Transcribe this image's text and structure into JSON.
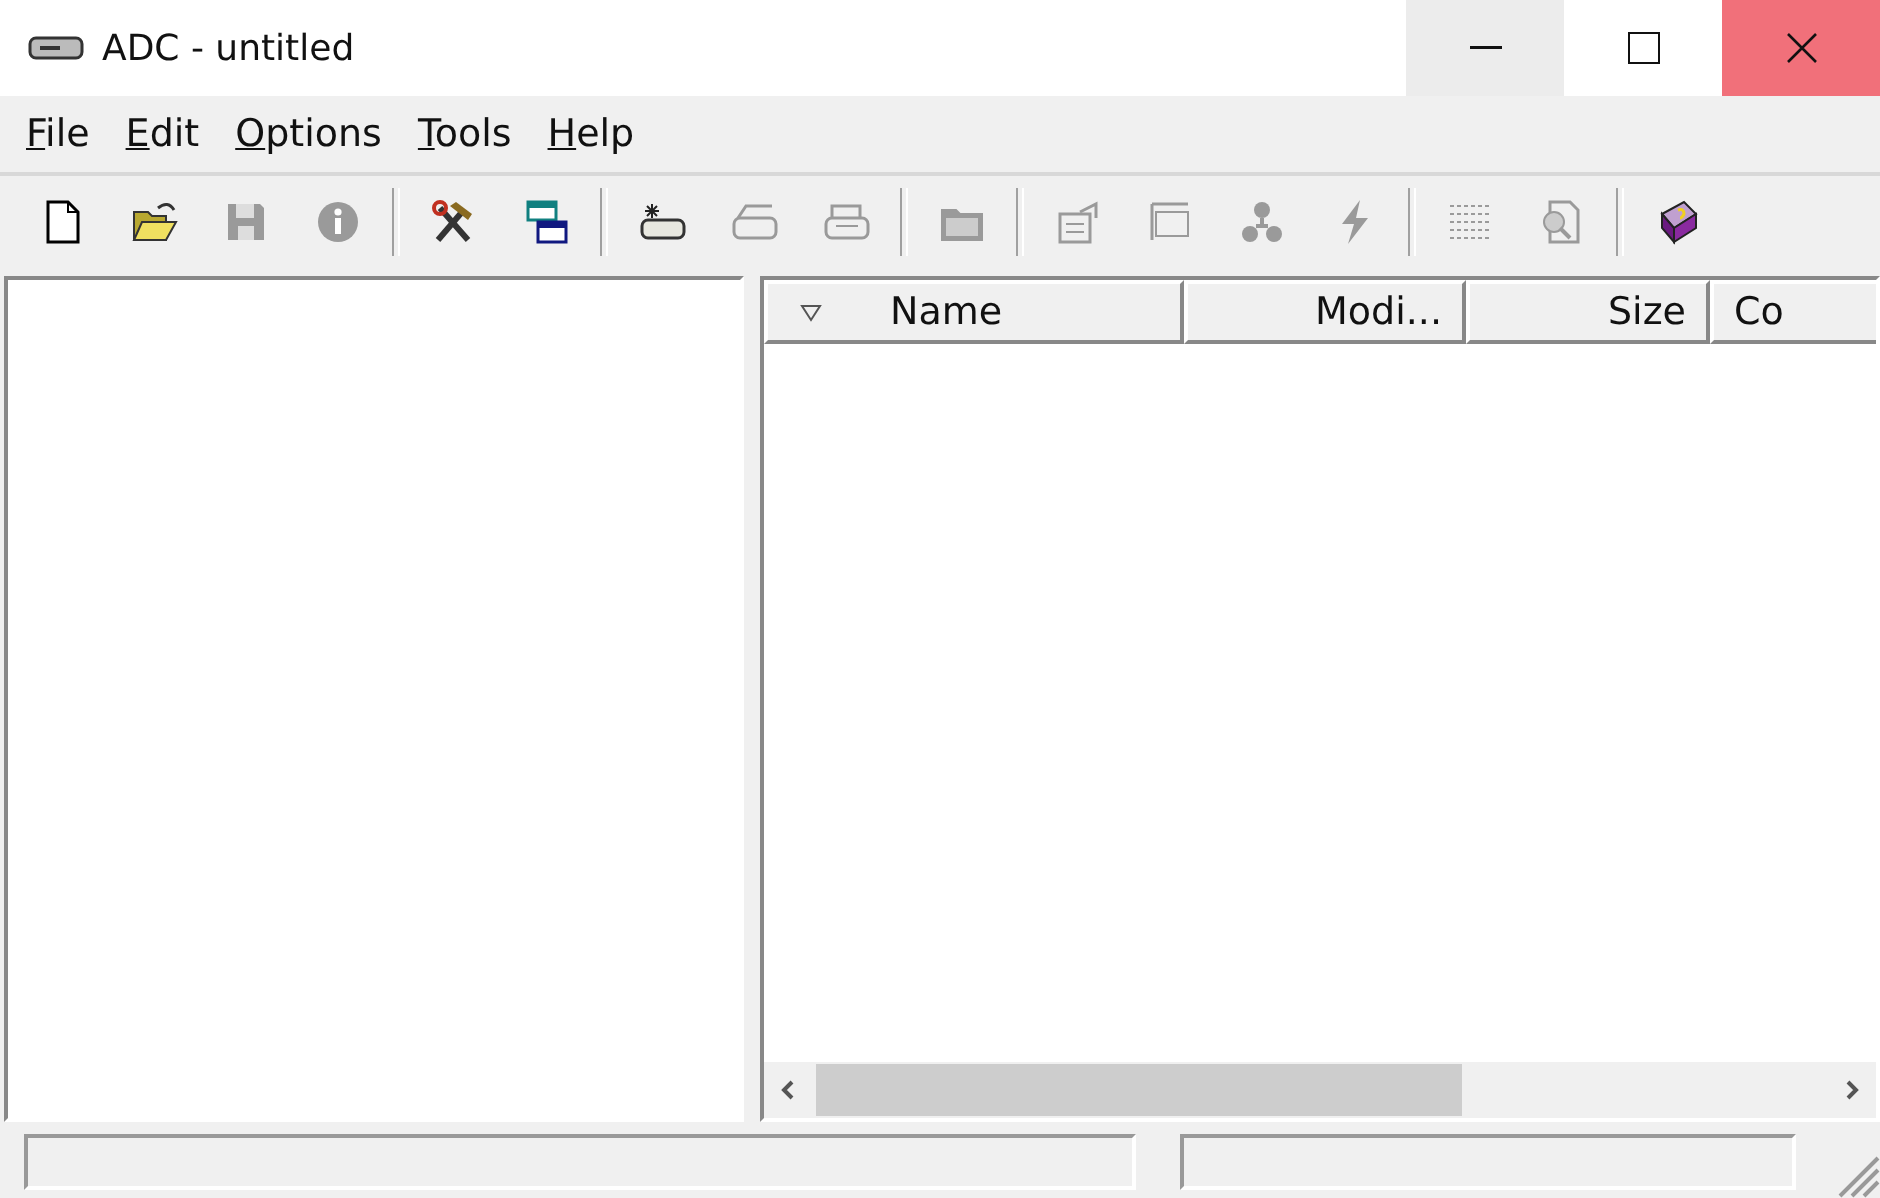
{
  "window": {
    "title": "ADC - untitled"
  },
  "menu": [
    {
      "label": "File"
    },
    {
      "label": "Edit"
    },
    {
      "label": "Options"
    },
    {
      "label": "Tools"
    },
    {
      "label": "Help"
    }
  ],
  "toolbar": [
    [
      {
        "disabled": false
      },
      {
        "disabled": false
      },
      {
        "disabled": true
      },
      {
        "disabled": true
      }
    ],
    [
      {
        "disabled": false
      },
      {
        "disabled": false
      }
    ],
    [
      {
        "disabled": false
      },
      {
        "disabled": true
      },
      {
        "disabled": true
      }
    ],
    [
      {
        "disabled": true
      }
    ],
    [
      {
        "disabled": true
      },
      {
        "disabled": true
      },
      {
        "disabled": true
      },
      {
        "disabled": true
      }
    ],
    [
      {
        "disabled": true
      },
      {
        "disabled": true
      }
    ],
    [
      {
        "disabled": false
      }
    ]
  ],
  "file_list": {
    "columns": [
      {
        "label": "Name"
      },
      {
        "label": "Modi..."
      },
      {
        "label": "Size"
      },
      {
        "label": "Co"
      }
    ]
  }
}
